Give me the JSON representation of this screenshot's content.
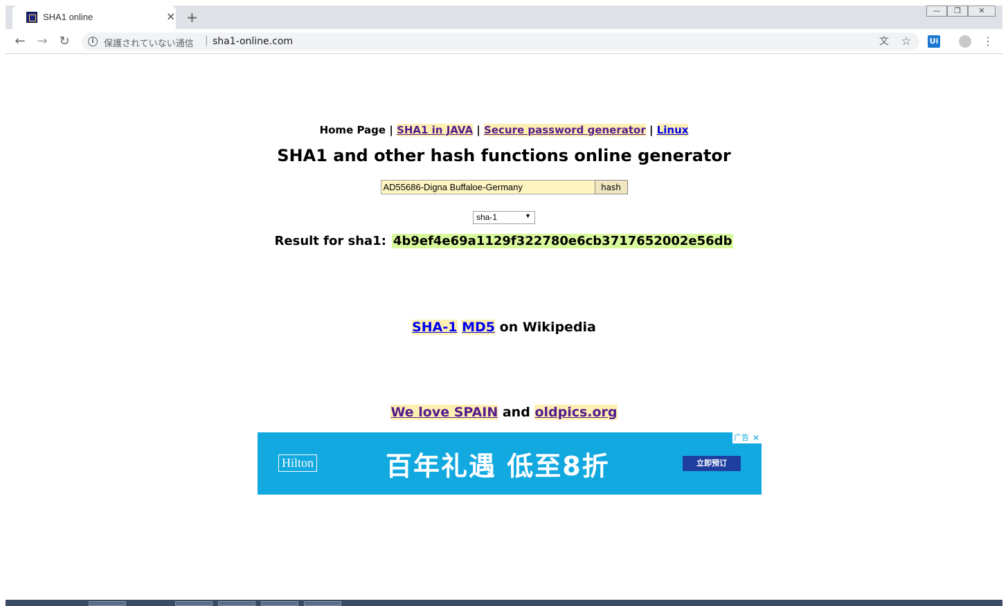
{
  "browser": {
    "tab_title": "SHA1 online",
    "tab_close": "×",
    "new_tab": "+",
    "window_controls": {
      "minimize": "—",
      "restore": "❐",
      "close": "✕"
    },
    "nav": {
      "back": "←",
      "forward": "→",
      "reload": "↻"
    },
    "security_text": "保護されていない通信",
    "url_separator": "|",
    "url": "sha1-online.com",
    "ext_label": "Ui",
    "icons": {
      "info": "i",
      "translate": "文",
      "star": "☆",
      "menu": "⋮"
    }
  },
  "page": {
    "nav": {
      "home": "Home Page",
      "sep1": " | ",
      "link1": "SHA1 in JAVA",
      "sep2": " | ",
      "link2": "Secure password generator",
      "sep3": " | ",
      "link3": "Linux"
    },
    "title": "SHA1 and other hash functions online generator",
    "input_value": "AD55686-Digna Buffaloe-Germany",
    "hash_button": "hash",
    "algorithm": "sha-1",
    "result_label": "Result for sha1:",
    "result_value": "4b9ef4e69a1129f322780e6cb3717652002e56db",
    "wiki": {
      "link1": "SHA-1",
      "link2": "MD5",
      "suffix": " on Wikipedia"
    },
    "spain": {
      "link1": "We love SPAIN",
      "mid": " and ",
      "link2": "oldpics.org"
    },
    "ad": {
      "logo": "Hilton",
      "headline": "百年礼遇 低至8折",
      "button": "立即预订",
      "badge": "广告",
      "close": "✕"
    }
  }
}
